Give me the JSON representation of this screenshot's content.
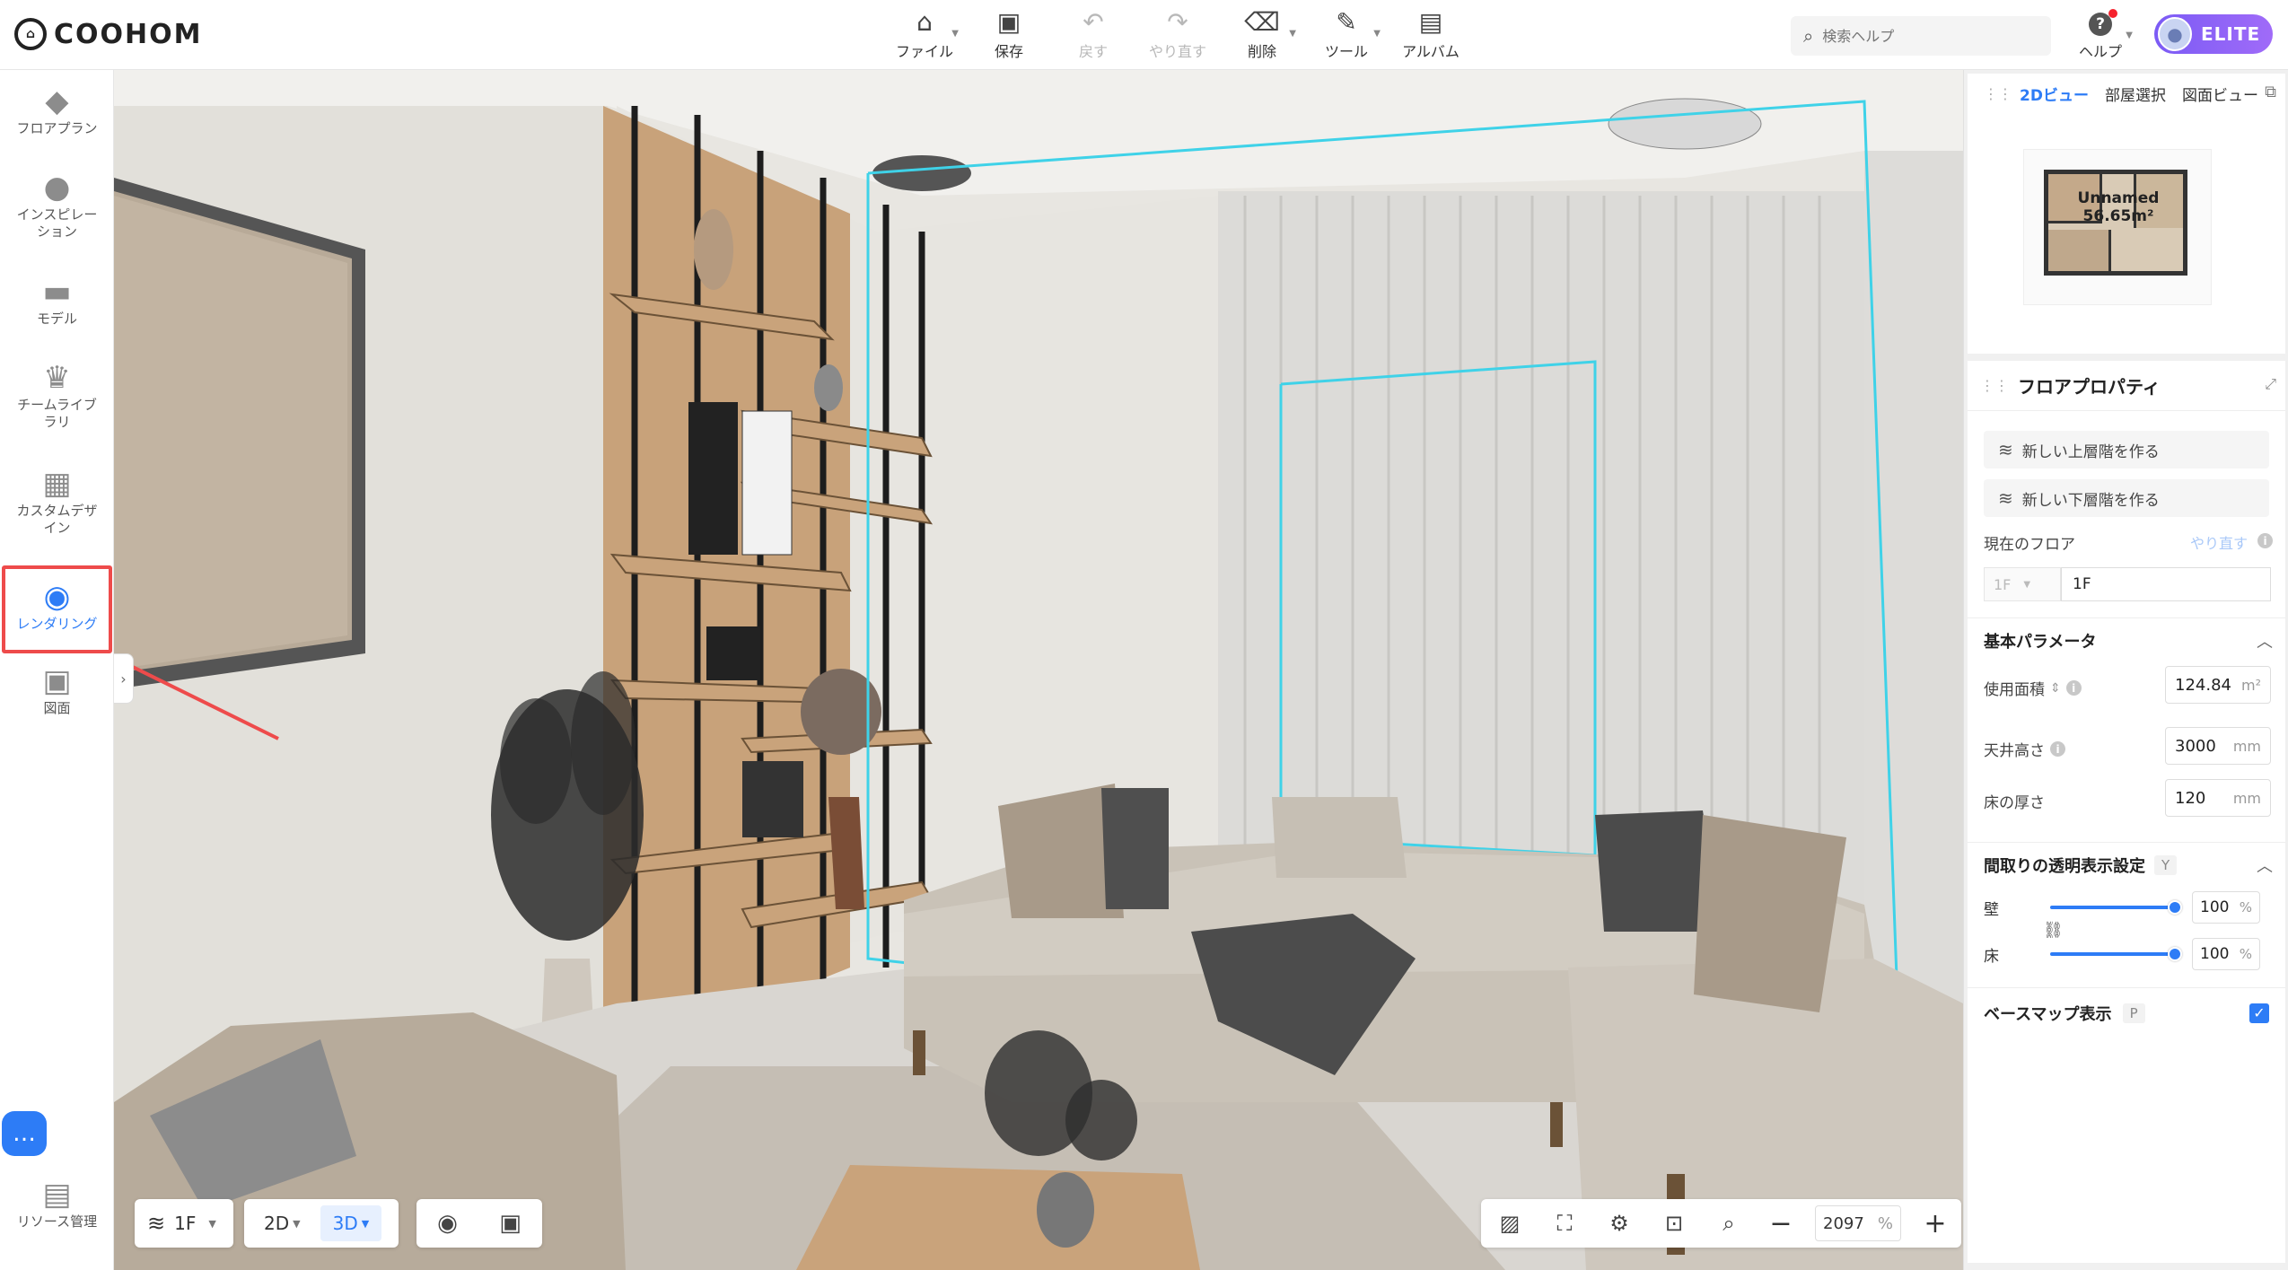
{
  "app": {
    "logo_text": "COOHOM"
  },
  "toolbar": {
    "items": [
      {
        "label": "ファイル",
        "icon": "file-icon",
        "has_menu": true,
        "disabled": false
      },
      {
        "label": "保存",
        "icon": "save-icon",
        "has_menu": false,
        "disabled": false
      },
      {
        "label": "戻す",
        "icon": "undo-icon",
        "has_menu": false,
        "disabled": true
      },
      {
        "label": "やり直す",
        "icon": "redo-icon",
        "has_menu": false,
        "disabled": true
      },
      {
        "label": "削除",
        "icon": "eraser-icon",
        "has_menu": true,
        "disabled": false
      },
      {
        "label": "ツール",
        "icon": "wrench-icon",
        "has_menu": true,
        "disabled": false
      },
      {
        "label": "アルバム",
        "icon": "album-icon",
        "has_menu": false,
        "disabled": false
      }
    ]
  },
  "search": {
    "placeholder": "検索ヘルプ"
  },
  "help": {
    "label": "ヘルプ",
    "has_notification": true
  },
  "user": {
    "tier": "ELITE"
  },
  "sidebar": {
    "items": [
      {
        "label": "フロアプラン",
        "icon": "floorplan-icon"
      },
      {
        "label": "インスピレーション",
        "icon": "lightbulb-icon"
      },
      {
        "label": "モデル",
        "icon": "sofa-icon"
      },
      {
        "label": "チームライブラリ",
        "icon": "crown-icon"
      },
      {
        "label": "カスタムデザイン",
        "icon": "cabinet-icon"
      },
      {
        "label": "レンダリング",
        "icon": "camera-icon",
        "active": true
      },
      {
        "label": "図面",
        "icon": "drawing-icon"
      }
    ],
    "bottom_label": "リソース管理"
  },
  "viewport_controls": {
    "floor": "1F",
    "mode_2d": "2D",
    "mode_3d": "3D",
    "active_mode": "3D",
    "zoom_value": "2097",
    "zoom_unit": "%"
  },
  "minimap": {
    "tabs": [
      "2Dビュー",
      "部屋選択",
      "図面ビュー"
    ],
    "active_tab": "2Dビュー",
    "plan_name": "Unnamed",
    "plan_area": "56.65m²"
  },
  "floor_properties": {
    "title": "フロアプロパティ",
    "btn_new_upper": "新しい上層階を作る",
    "btn_new_lower": "新しい下層階を作る",
    "current_floor_label": "現在のフロア",
    "redo_link": "やり直す",
    "floor_select": "1F",
    "floor_name": "1F",
    "basic_params_title": "基本パラメータ",
    "area_label": "使用面積",
    "area_value": "124.84",
    "area_unit": "m²",
    "ceiling_label": "天井高さ",
    "ceiling_value": "3000",
    "ceiling_unit": "mm",
    "floor_thick_label": "床の厚さ",
    "floor_thick_value": "120",
    "floor_thick_unit": "mm",
    "transparency_title": "間取りの透明表示設定",
    "transparency_key": "Y",
    "wall_label": "壁",
    "wall_value": "100",
    "floor_label": "床",
    "floor_value": "100",
    "percent": "%",
    "basemap_label": "ベースマップ表示",
    "basemap_key": "P",
    "basemap_checked": true
  },
  "colors": {
    "accent": "#2d7cf6",
    "highlight": "#ee4b4b",
    "elite_start": "#7b5bf5",
    "elite_end": "#a06bf8",
    "selection_outline": "#3fd2e8"
  }
}
